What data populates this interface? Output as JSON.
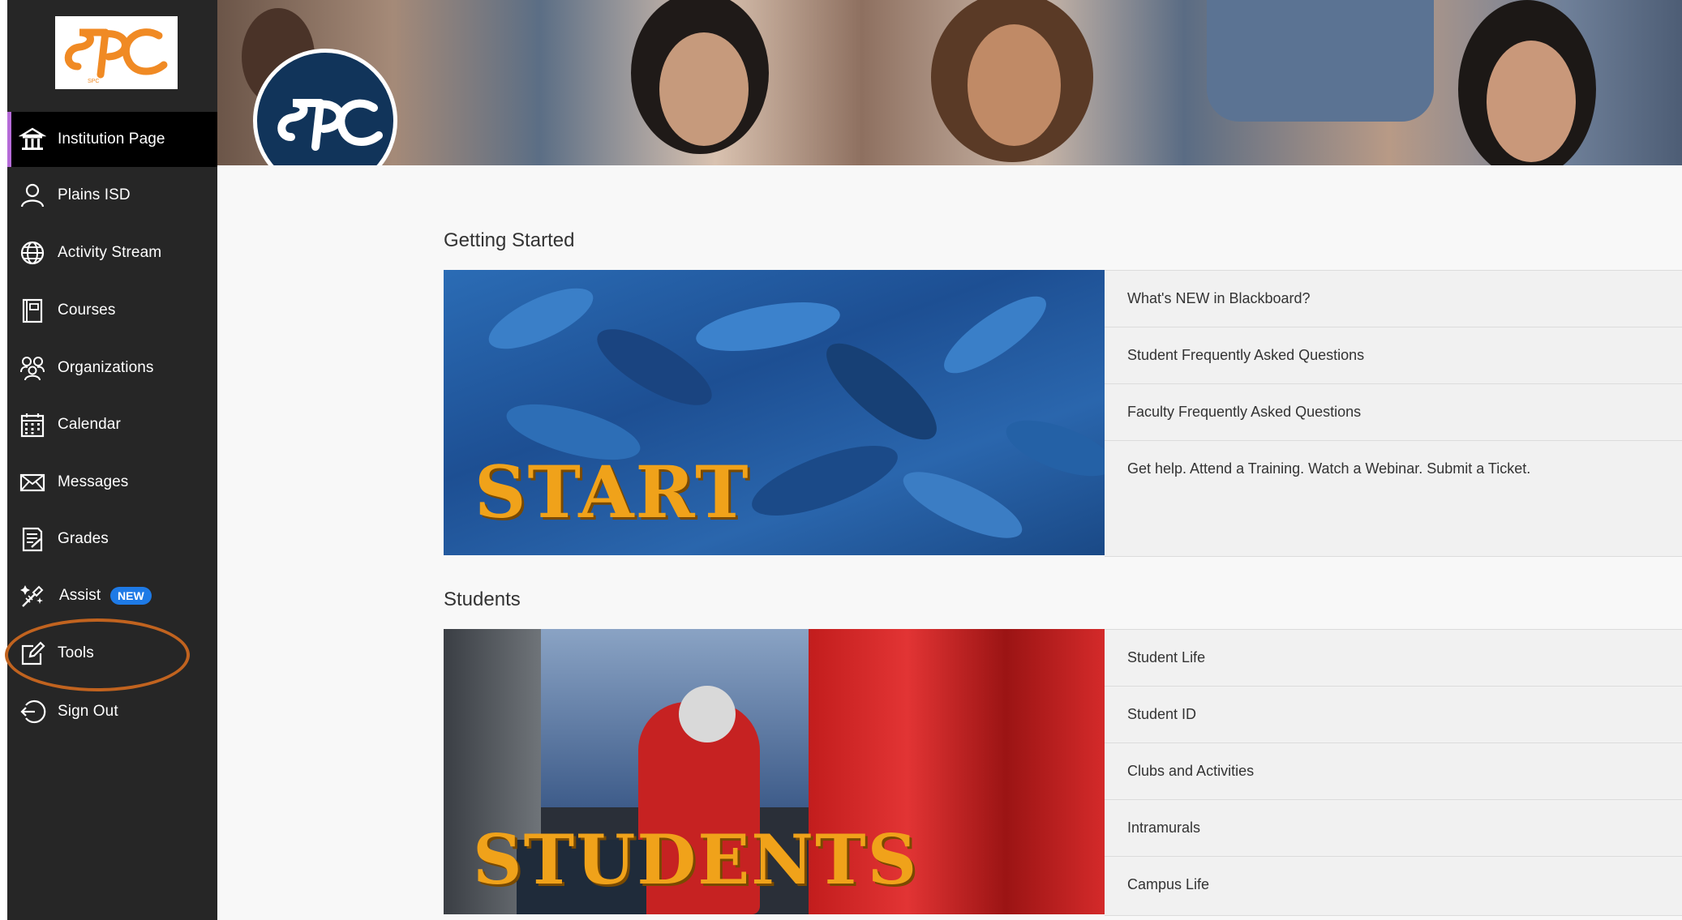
{
  "brand": {
    "logo_text": "SPC",
    "accent": "#f08a24",
    "navy": "#11345a"
  },
  "sidebar": {
    "items": [
      {
        "label": "Institution Page",
        "icon": "institution-icon",
        "active": true
      },
      {
        "label": "Plains ISD",
        "icon": "user-icon"
      },
      {
        "label": "Activity Stream",
        "icon": "globe-icon"
      },
      {
        "label": "Courses",
        "icon": "book-icon"
      },
      {
        "label": "Organizations",
        "icon": "organizations-icon"
      },
      {
        "label": "Calendar",
        "icon": "calendar-icon"
      },
      {
        "label": "Messages",
        "icon": "envelope-icon"
      },
      {
        "label": "Grades",
        "icon": "grades-icon"
      },
      {
        "label": "Assist",
        "icon": "assist-icon",
        "badge": "NEW"
      },
      {
        "label": "Tools",
        "icon": "tools-icon",
        "highlighted": true
      },
      {
        "label": "Sign Out",
        "icon": "sign-out-icon"
      }
    ]
  },
  "sections": [
    {
      "title": "Getting Started",
      "image_word": "START",
      "links": [
        "What's NEW in Blackboard?",
        "Student Frequently Asked Questions",
        "Faculty Frequently Asked Questions",
        "Get help. Attend a Training. Watch a Webinar. Submit a Ticket."
      ]
    },
    {
      "title": "Students",
      "image_word": "STUDENTS",
      "links": [
        "Student Life",
        "Student ID",
        "Clubs and Activities",
        "Intramurals",
        "Campus Life"
      ]
    }
  ]
}
